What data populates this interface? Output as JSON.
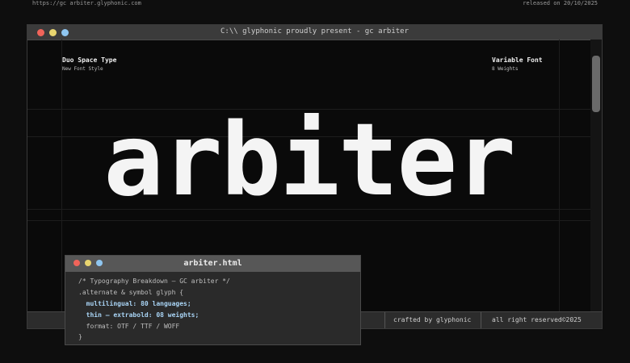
{
  "top": {
    "url": "https://gc arbiter.glyphonic.com",
    "release": "released on 20/10/2025"
  },
  "window": {
    "title": "C:\\\\ glyphonic proudly present - gc arbiter",
    "left_label": "Duo Space Type",
    "left_sub": "New Font Style",
    "right_label": "Variable Font",
    "right_sub": "8 Weights",
    "hero": "arbiter",
    "footer_credit": "crafted by glyphonic",
    "footer_rights": "all right reserved©2025"
  },
  "code_window": {
    "title": "arbiter.html",
    "lines": [
      "/* Typography Breakdown — GC arbiter */",
      ".alternate & symbol glyph {",
      "  multilingual: 80 languages;",
      "  thin – extrabold: 08 weights;",
      "  format: OTF / TTF / WOFF",
      "}"
    ]
  },
  "colors": {
    "background": "#0e0e0e",
    "dot_red": "#f0645a",
    "dot_yellow": "#e8d56f",
    "dot_blue": "#8fc6f0",
    "highlight": "#a9d4f5"
  },
  "icons": [
    "close-dot",
    "minimize-dot",
    "maximize-dot"
  ]
}
